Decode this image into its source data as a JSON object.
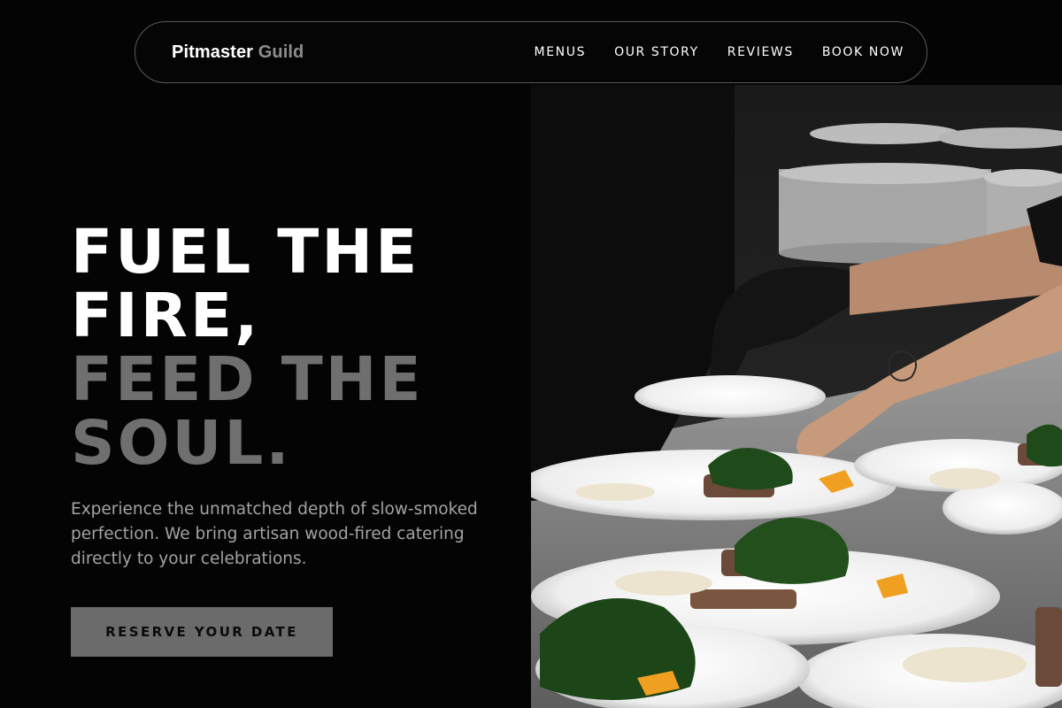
{
  "nav": {
    "brand_primary": "Pitmaster",
    "brand_secondary": "Guild",
    "links": [
      "MENUS",
      "OUR STORY",
      "REVIEWS",
      "BOOK NOW"
    ]
  },
  "hero": {
    "title_line1": "FUEL THE",
    "title_line2": "FIRE,",
    "title_line3": "FEED THE",
    "title_line4": "SOUL.",
    "subtitle": "Experience the unmatched depth of slow-smoked perfection. We bring artisan wood-fired catering directly to your celebrations.",
    "cta_label": "RESERVE YOUR DATE"
  },
  "photo": {
    "subject": "chefs plating dishes in a kitchen"
  },
  "colors": {
    "background": "#040404",
    "accent_grey": "#6f6f6f",
    "cta_bg": "#6b6b6b"
  }
}
